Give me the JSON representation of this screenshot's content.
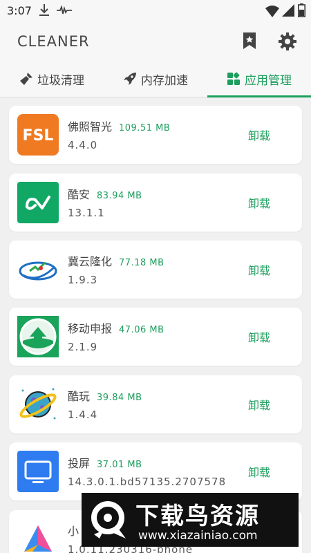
{
  "status_bar": {
    "time": "3:07"
  },
  "app_bar": {
    "title": "CLEANER",
    "icons": [
      "bookmark-icon",
      "settings-gear-icon"
    ]
  },
  "tabs": [
    {
      "label": "垃圾清理",
      "icon": "broom-icon",
      "active": false
    },
    {
      "label": "内存加速",
      "icon": "rocket-icon",
      "active": false
    },
    {
      "label": "应用管理",
      "icon": "apps-grid-icon",
      "active": true
    }
  ],
  "apps": [
    {
      "name": "佛照智光",
      "size": "109.51 MB",
      "version": "4.4.0",
      "action": "卸载",
      "icon": "fsl-app-icon",
      "icon_text": "FSL"
    },
    {
      "name": "酷安",
      "size": "83.94 MB",
      "version": "13.1.1",
      "action": "卸载",
      "icon": "coolapk-app-icon"
    },
    {
      "name": "冀云隆化",
      "size": "77.18 MB",
      "version": "1.9.3",
      "action": "卸载",
      "icon": "jiyun-app-icon"
    },
    {
      "name": "移动申报",
      "size": "47.06 MB",
      "version": "2.1.9",
      "action": "卸载",
      "icon": "mobile-declare-app-icon"
    },
    {
      "name": "酷玩",
      "size": "39.84 MB",
      "version": "1.4.4",
      "action": "卸载",
      "icon": "planet-app-icon"
    },
    {
      "name": "投屏",
      "size": "37.01 MB",
      "version": "14.3.0.1.bd57135.2707578",
      "action": "卸载",
      "icon": "monitor-app-icon"
    },
    {
      "name": "小",
      "size": "",
      "version": "1.0.11.230316-phone",
      "action": "",
      "icon": "triangle-app-icon"
    }
  ],
  "watermark": {
    "title": "下载鸟资源",
    "url": "www.xiazainiao.com"
  },
  "colors": {
    "accent": "#1b9e5c",
    "background": "#f0f0f0",
    "card": "#ffffff"
  }
}
